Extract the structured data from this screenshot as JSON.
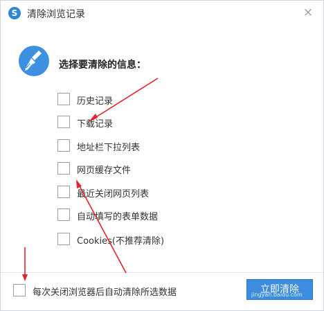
{
  "window": {
    "title": "清除浏览记录",
    "close_glyph": "×",
    "app_icon_glyph": "S"
  },
  "heading": "选择要清除的信息：",
  "options": [
    {
      "label": "历史记录",
      "checked": false
    },
    {
      "label": "下载记录",
      "checked": false
    },
    {
      "label": "地址栏下拉列表",
      "checked": false
    },
    {
      "label": "网页缓存文件",
      "checked": false
    },
    {
      "label": "最近关闭网页列表",
      "checked": false
    },
    {
      "label": "自动填写的表单数据",
      "checked": false
    },
    {
      "label": "Cookies(不推荐清除)",
      "checked": false
    }
  ],
  "footer": {
    "auto_clear_label": "每次关闭浏览器后自动清除所选数据",
    "auto_clear_checked": false,
    "clean_button_label": "立即清除"
  },
  "watermark_text": "jingyan.baidu.com",
  "colors": {
    "accent": "#3c8de0",
    "annotation_arrow": "#e0242b",
    "broom_badge": "#3d8fe0"
  },
  "icons": {
    "app": "sogou-browser-icon",
    "close": "close-icon",
    "broom": "broom-icon"
  }
}
